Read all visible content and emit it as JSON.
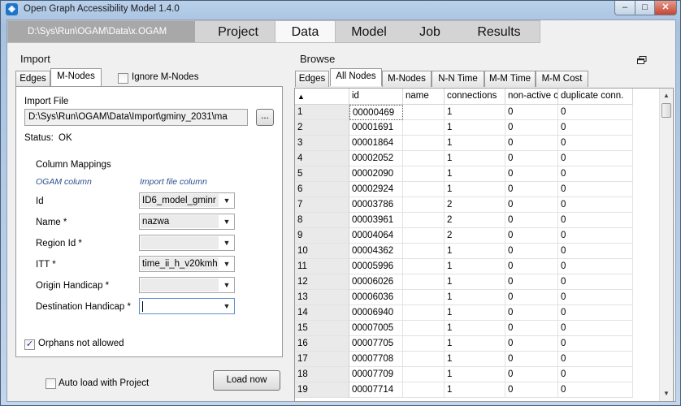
{
  "window": {
    "title": "Open Graph Accessibility Model 1.4.0",
    "controls": {
      "minimize": "–",
      "maximize": "□",
      "close": "✕"
    }
  },
  "nav": {
    "path": "D:\\Sys\\Run\\OGAM\\Data\\x.OGAM",
    "tabs": [
      "Project",
      "Data",
      "Model",
      "Job",
      "Results"
    ],
    "active_tab": "Data"
  },
  "import": {
    "title": "Import",
    "tabs": [
      "Edges",
      "M-Nodes"
    ],
    "active_tab": "M-Nodes",
    "ignore_label": "Ignore M-Nodes",
    "ignore_checked": false,
    "file_label": "Import File",
    "file_path": "D:\\Sys\\Run\\OGAM\\Data\\Import\\gminy_2031\\ma",
    "browse_label": "...",
    "status_label": "Status:",
    "status_value": "OK",
    "mappings_title": "Column Mappings",
    "col_ogam": "OGAM column",
    "col_import": "Import file column",
    "mappings": [
      {
        "label": "Id",
        "value": "ID6_model_gminr"
      },
      {
        "label": "Name *",
        "value": "nazwa"
      },
      {
        "label": "Region Id *",
        "value": ""
      },
      {
        "label": "ITT *",
        "value": "time_ii_h_v20kmh"
      },
      {
        "label": "Origin Handicap *",
        "value": ""
      },
      {
        "label": "Destination Handicap *",
        "value": ""
      }
    ],
    "orphans_label": "Orphans not allowed",
    "orphans_checked": true,
    "autoload_label": "Auto load with Project",
    "autoload_checked": false,
    "load_button": "Load now"
  },
  "browse": {
    "title": "Browse",
    "tabs": [
      "Edges",
      "All Nodes",
      "M-Nodes",
      "N-N Time",
      "M-M Time",
      "M-M Cost"
    ],
    "active_tab": "All Nodes",
    "columns": [
      "▲",
      "id",
      "name",
      "connections",
      "non-active conn.",
      "duplicate conn."
    ],
    "rows": [
      [
        "1",
        "00000469",
        "",
        "1",
        "0",
        "0"
      ],
      [
        "2",
        "00001691",
        "",
        "1",
        "0",
        "0"
      ],
      [
        "3",
        "00001864",
        "",
        "1",
        "0",
        "0"
      ],
      [
        "4",
        "00002052",
        "",
        "1",
        "0",
        "0"
      ],
      [
        "5",
        "00002090",
        "",
        "1",
        "0",
        "0"
      ],
      [
        "6",
        "00002924",
        "",
        "1",
        "0",
        "0"
      ],
      [
        "7",
        "00003786",
        "",
        "2",
        "0",
        "0"
      ],
      [
        "8",
        "00003961",
        "",
        "2",
        "0",
        "0"
      ],
      [
        "9",
        "00004064",
        "",
        "2",
        "0",
        "0"
      ],
      [
        "10",
        "00004362",
        "",
        "1",
        "0",
        "0"
      ],
      [
        "11",
        "00005996",
        "",
        "1",
        "0",
        "0"
      ],
      [
        "12",
        "00006026",
        "",
        "1",
        "0",
        "0"
      ],
      [
        "13",
        "00006036",
        "",
        "1",
        "0",
        "0"
      ],
      [
        "14",
        "00006940",
        "",
        "1",
        "0",
        "0"
      ],
      [
        "15",
        "00007005",
        "",
        "1",
        "0",
        "0"
      ],
      [
        "16",
        "00007705",
        "",
        "1",
        "0",
        "0"
      ],
      [
        "17",
        "00007708",
        "",
        "1",
        "0",
        "0"
      ],
      [
        "18",
        "00007709",
        "",
        "1",
        "0",
        "0"
      ],
      [
        "19",
        "00007714",
        "",
        "1",
        "0",
        "0"
      ]
    ]
  }
}
